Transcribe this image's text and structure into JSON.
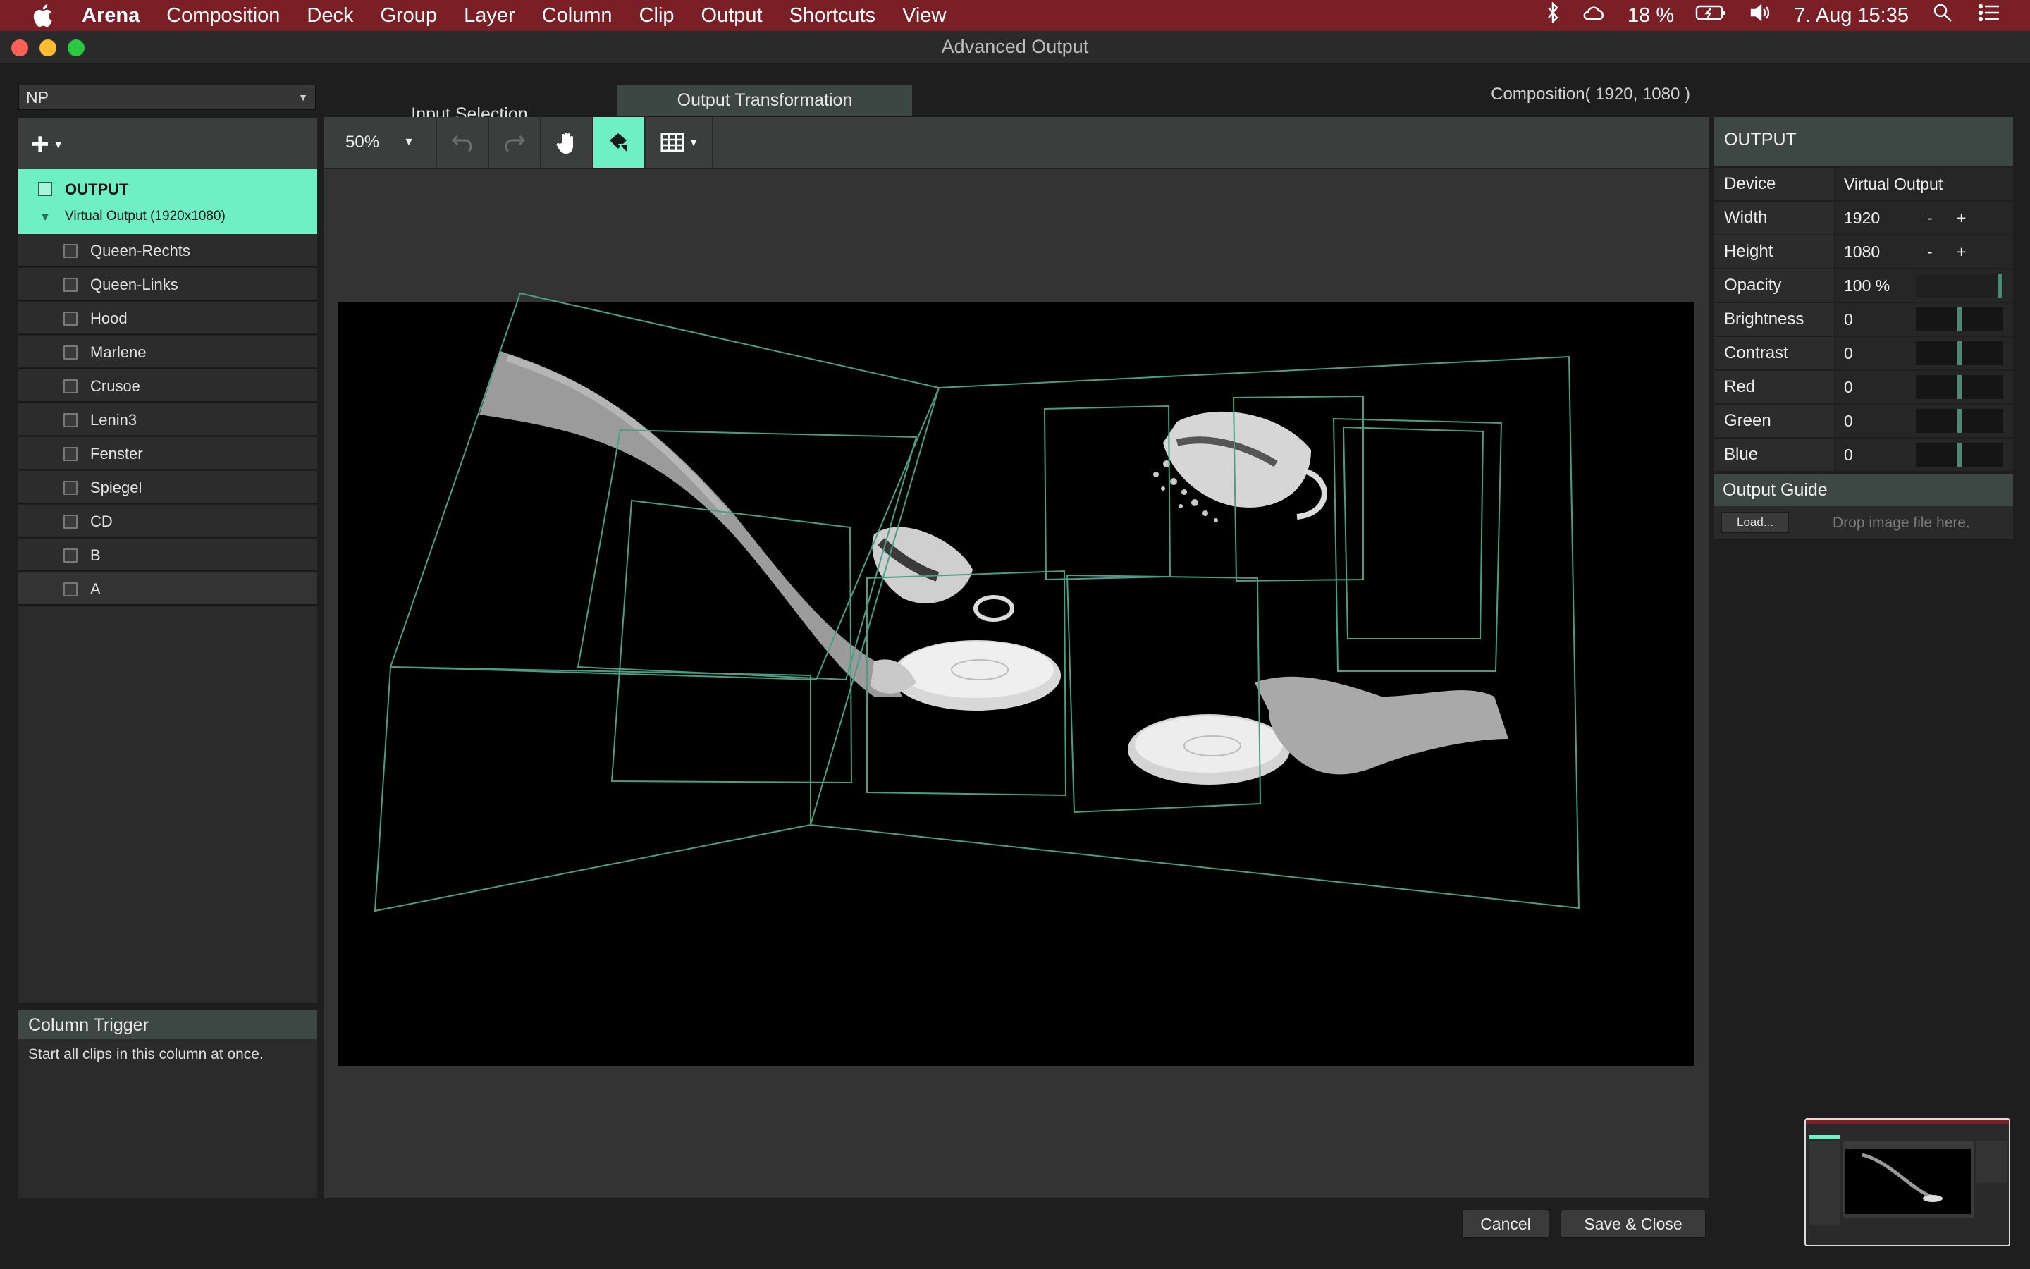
{
  "menubar": {
    "app": "Arena",
    "items": [
      "Composition",
      "Deck",
      "Group",
      "Layer",
      "Column",
      "Clip",
      "Output",
      "Shortcuts",
      "View"
    ],
    "battery": "18 %",
    "datetime": "7. Aug  15:35"
  },
  "window": {
    "title": "Advanced Output"
  },
  "preset": {
    "value": "NP"
  },
  "tabs": {
    "input_selection": "Input Selection",
    "output_transformation": "Output Transformation"
  },
  "composition_label": "Composition( 1920, 1080 )",
  "toolbar": {
    "zoom": "50%"
  },
  "layers": {
    "output": {
      "name": "OUTPUT",
      "sub": "Virtual Output (1920x1080)"
    },
    "items": [
      "Queen-Rechts",
      "Queen-Links",
      "Hood",
      "Marlene",
      "Crusoe",
      "Lenin3",
      "Fenster",
      "Spiegel",
      "CD",
      "B",
      "A"
    ]
  },
  "column_trigger": {
    "title": "Column Trigger",
    "description": "Start all clips in this column at once."
  },
  "output_panel": {
    "title": "OUTPUT",
    "device_label": "Device",
    "device_value": "Virtual Output",
    "width_label": "Width",
    "width_value": "1920",
    "height_label": "Height",
    "height_value": "1080",
    "opacity_label": "Opacity",
    "opacity_value": "100 %",
    "brightness_label": "Brightness",
    "brightness_value": "0",
    "contrast_label": "Contrast",
    "contrast_value": "0",
    "red_label": "Red",
    "red_value": "0",
    "green_label": "Green",
    "green_value": "0",
    "blue_label": "Blue",
    "blue_value": "0",
    "minus": "-",
    "plus": "+",
    "guide_title": "Output Guide",
    "load_label": "Load...",
    "drop_hint": "Drop image file here."
  },
  "footer": {
    "cancel": "Cancel",
    "save": "Save & Close"
  },
  "colors": {
    "accent": "#6ef0c4",
    "menubar": "#7a1f26",
    "mesh": "#4a9e86"
  }
}
